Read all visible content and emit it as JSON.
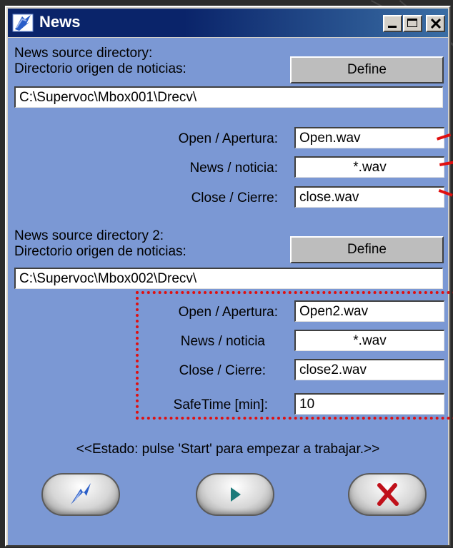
{
  "window": {
    "title": "News"
  },
  "source1": {
    "label_line1": "News source directory:",
    "label_line2": "Directorio origen de noticias:",
    "define_label": "Define",
    "path": "C:\\Supervoc\\Mbox001\\Drecv\\",
    "open_label": "Open / Apertura:",
    "open_value": "Open.wav",
    "news_label": "News / noticia:",
    "news_value": "*.wav",
    "close_label": "Close / Cierre:",
    "close_value": "close.wav"
  },
  "source2": {
    "label_line1": "News source directory 2:",
    "label_line2": "Directorio origen de noticias:",
    "define_label": "Define",
    "path": "C:\\Supervoc\\Mbox002\\Drecv\\",
    "open_label": "Open / Apertura:",
    "open_value": "Open2.wav",
    "news_label": "News / noticia",
    "news_value": "*.wav",
    "close_label": "Close / Cierre:",
    "close_value": "close2.wav",
    "safetime_label": "SafeTime [min]:",
    "safetime_value": "10"
  },
  "status_text": "<<Estado: pulse 'Start' para empezar a trabajar.>>",
  "buttons": {
    "configure_icon": "lightning-icon",
    "start_icon": "play-icon",
    "exit_icon": "x-icon"
  },
  "colors": {
    "client_bg": "#7b98d4",
    "titlebar": "#0a246a",
    "highlight": "#e01010"
  }
}
